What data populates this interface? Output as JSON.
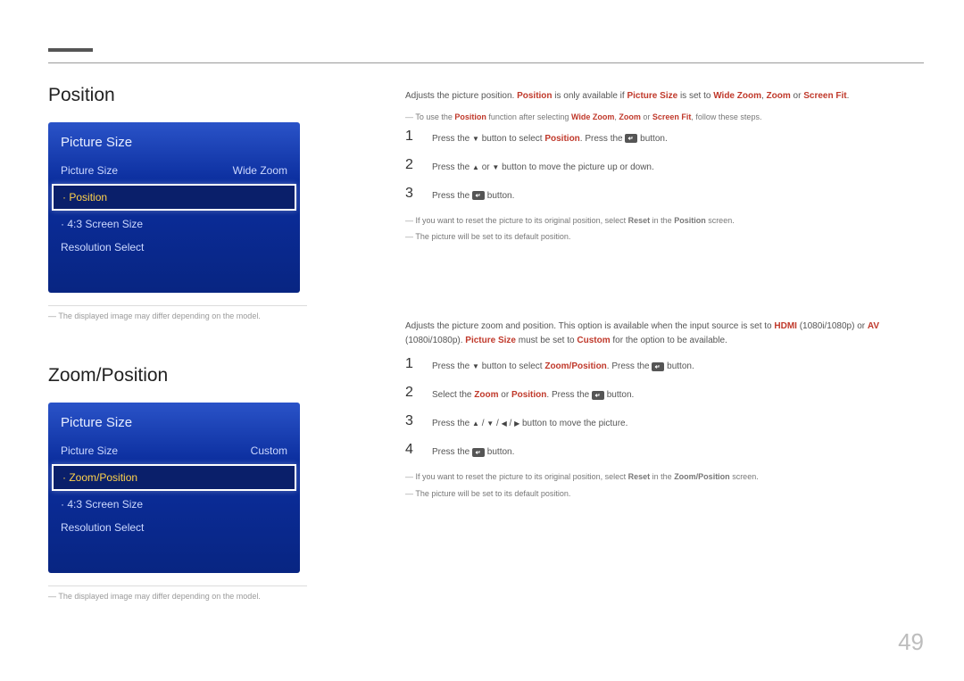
{
  "page_number": "49",
  "section1": {
    "title": "Position",
    "menu": {
      "header": "Picture Size",
      "rows": [
        {
          "label": "Picture Size",
          "value": "Wide Zoom",
          "selected": false,
          "dot": false
        },
        {
          "label": "Position",
          "value": "",
          "selected": true,
          "dot": true
        },
        {
          "label": "4:3 Screen Size",
          "value": "",
          "selected": false,
          "dot": true
        },
        {
          "label": "Resolution Select",
          "value": "",
          "selected": false,
          "dot": false
        }
      ]
    },
    "footnote": "The displayed image may differ depending on the model.",
    "intro": {
      "p1a": "Adjusts the picture position. ",
      "p1b": "Position",
      "p1c": " is only available if ",
      "p1d": "Picture Size",
      "p1e": " is set to ",
      "p1f": "Wide Zoom",
      "p1g": ", ",
      "p1h": "Zoom",
      "p1i": " or ",
      "p1j": "Screen Fit",
      "p1k": ".",
      "note_a": "To use the ",
      "note_b": "Position",
      "note_c": " function after selecting ",
      "note_d": "Wide Zoom",
      "note_e": ", ",
      "note_f": "Zoom",
      "note_g": " or ",
      "note_h": "Screen Fit",
      "note_i": ", follow these steps."
    },
    "steps": {
      "s1a": "Press the ",
      "s1b": " button to select ",
      "s1c": "Position",
      "s1d": ". Press the ",
      "s1e": " button.",
      "s2a": "Press the ",
      "s2b": " or ",
      "s2c": " button to move the picture up or down.",
      "s3a": "Press the ",
      "s3b": " button."
    },
    "notes": {
      "n1a": "If you want to reset the picture to its original position, select ",
      "n1b": "Reset",
      "n1c": " in the ",
      "n1d": "Position",
      "n1e": " screen.",
      "n2": "The picture will be set to its default position."
    }
  },
  "section2": {
    "title": "Zoom/Position",
    "menu": {
      "header": "Picture Size",
      "rows": [
        {
          "label": "Picture Size",
          "value": "Custom",
          "selected": false,
          "dot": false
        },
        {
          "label": "Zoom/Position",
          "value": "",
          "selected": true,
          "dot": true
        },
        {
          "label": "4:3 Screen Size",
          "value": "",
          "selected": false,
          "dot": true
        },
        {
          "label": "Resolution Select",
          "value": "",
          "selected": false,
          "dot": false
        }
      ]
    },
    "footnote": "The displayed image may differ depending on the model.",
    "intro": {
      "p1a": "Adjusts the picture zoom and position. This option is available when the input source is set to ",
      "p1b": "HDMI",
      "p1c": " (1080i/1080p) or ",
      "p1d": "AV",
      "p1e": " (1080i/1080p). ",
      "p1f": "Picture Size",
      "p1g": " must be set to ",
      "p1h": "Custom",
      "p1i": " for the option to be available."
    },
    "steps": {
      "s1a": "Press the ",
      "s1b": " button to select ",
      "s1c": "Zoom/Position",
      "s1d": ". Press the ",
      "s1e": " button.",
      "s2a": "Select the ",
      "s2b": "Zoom",
      "s2c": " or ",
      "s2d": "Position",
      "s2e": ". Press the ",
      "s2f": " button.",
      "s3a": "Press the ",
      "s3b": " button to move the picture.",
      "s4a": "Press the ",
      "s4b": " button."
    },
    "notes": {
      "n1a": "If you want to reset the picture to its original position, select ",
      "n1b": "Reset",
      "n1c": " in the ",
      "n1d": "Zoom/Position",
      "n1e": " screen.",
      "n2": "The picture will be set to its default position."
    }
  }
}
